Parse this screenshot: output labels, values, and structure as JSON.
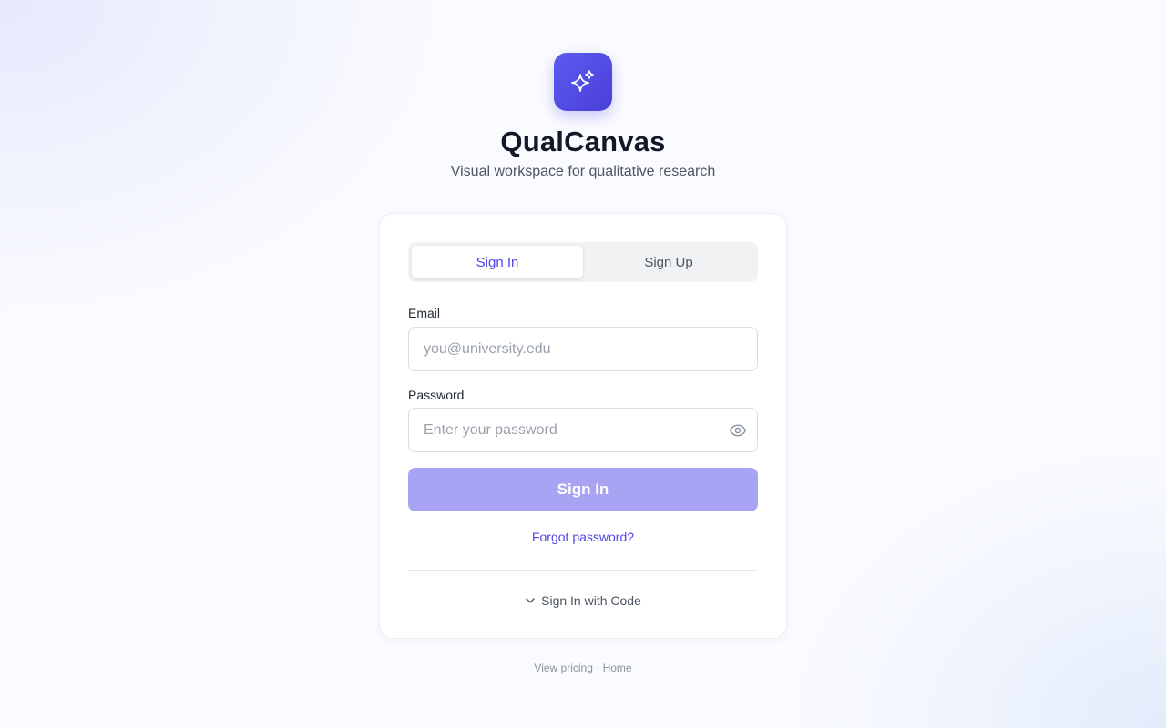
{
  "app": {
    "title": "QualCanvas",
    "subtitle": "Visual workspace for qualitative research",
    "logo_icon": "sparkles-icon",
    "accent_color": "#4f46e5"
  },
  "auth": {
    "tabs": [
      {
        "label": "Sign In",
        "active": true
      },
      {
        "label": "Sign Up",
        "active": false
      }
    ],
    "email": {
      "label": "Email",
      "placeholder": "you@university.edu",
      "value": ""
    },
    "password": {
      "label": "Password",
      "placeholder": "Enter your password",
      "value": "",
      "toggle_icon": "eye-icon"
    },
    "submit_label": "Sign In",
    "submit_color": "#a8a3f2",
    "forgot_label": "Forgot password?",
    "code_toggle_label": "Sign In with Code",
    "code_toggle_icon": "chevron-down-icon"
  },
  "footer": {
    "pricing_label": "View pricing",
    "separator": "·",
    "home_label": "Home"
  }
}
